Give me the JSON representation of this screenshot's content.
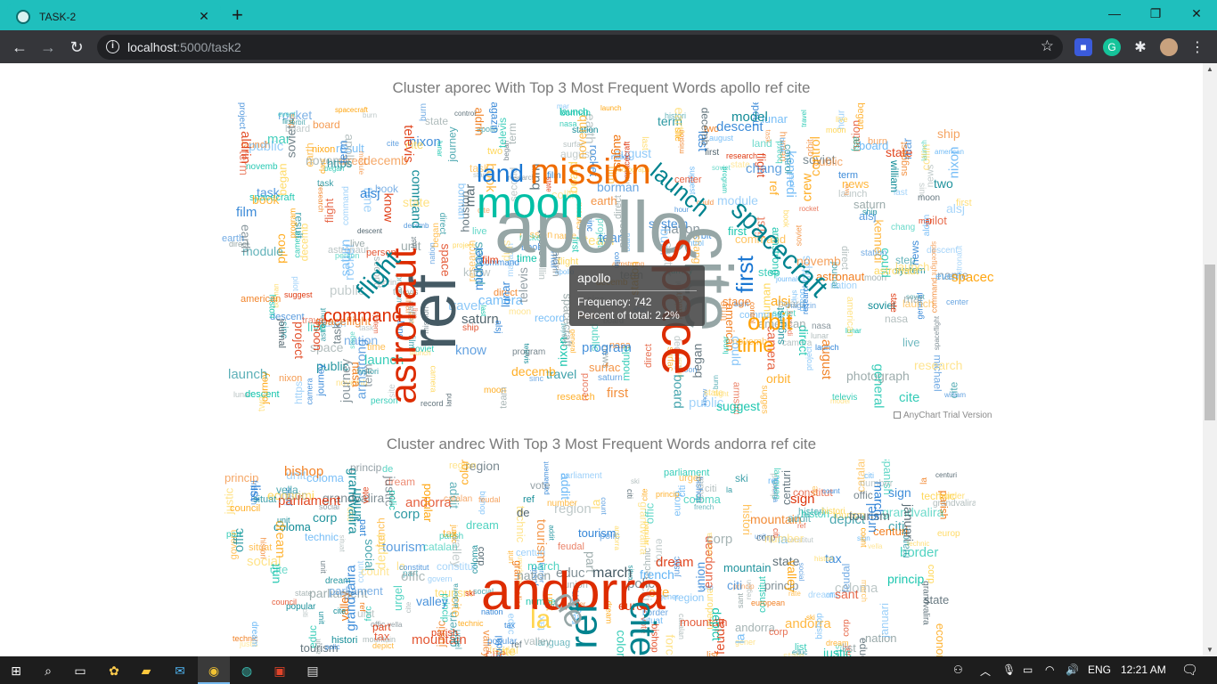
{
  "browser": {
    "tab_title": "TASK-2",
    "tab_close": "✕",
    "new_tab": "+",
    "url_host": "localhost",
    "url_rest": ":5000/task2",
    "window_controls": {
      "minimize": "—",
      "maximize": "❐",
      "close": "✕"
    }
  },
  "clusters": [
    {
      "title": "Cluster aporec With Top 3 Most Frequent Words apollo ref cite",
      "trial_label": "AnyChart Trial Version"
    },
    {
      "title": "Cluster andrec With Top 3 Most Frequent Words andorra ref cite"
    }
  ],
  "tooltip": {
    "word": "apollo",
    "frequency_line": "Frequency: 742",
    "percent_line": "Percent of total: 2.2%"
  },
  "colors": {
    "palette": [
      "#64b5f6",
      "#1976d2",
      "#ef6c00",
      "#ffd54f",
      "#455a64",
      "#96a6a6",
      "#dd2c00",
      "#00838f",
      "#00bfa5",
      "#ffa000"
    ]
  },
  "taskbar": {
    "language": "ENG",
    "time": "12:21 AM"
  }
}
